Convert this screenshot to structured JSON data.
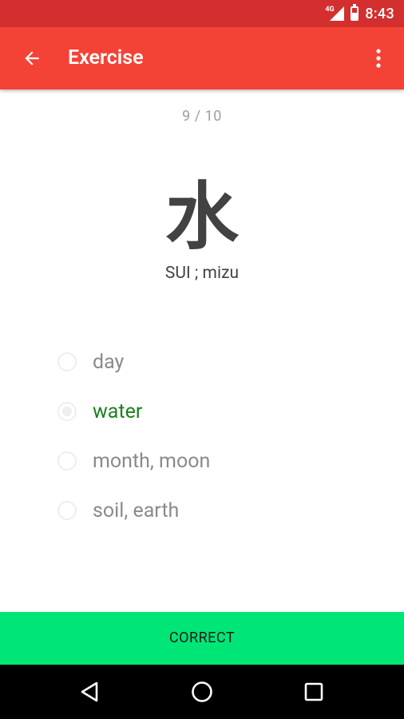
{
  "status_bar": {
    "network": "4G",
    "time": "8:43",
    "icons": [
      "signal-icon",
      "battery-icon"
    ]
  },
  "app_bar": {
    "title": "Exercise",
    "color": "#f44336",
    "icons": [
      "back-arrow-icon",
      "overflow-menu-icon"
    ]
  },
  "exercise": {
    "progress": "9 / 10",
    "kanji": "水",
    "reading": "SUI ; mizu",
    "options": [
      {
        "label": "day",
        "selected": false,
        "correct": false
      },
      {
        "label": "water",
        "selected": true,
        "correct": true
      },
      {
        "label": "month, moon",
        "selected": false,
        "correct": false
      },
      {
        "label": "soil, earth",
        "selected": false,
        "correct": false
      }
    ]
  },
  "result": {
    "label": "CORRECT",
    "color": "#00e676"
  },
  "nav_bar": {
    "icons": [
      "back-triangle-icon",
      "home-circle-icon",
      "recents-square-icon"
    ]
  }
}
